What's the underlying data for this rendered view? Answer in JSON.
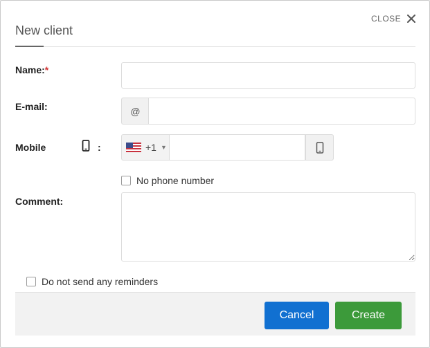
{
  "dialog": {
    "title": "New client",
    "close_label": "CLOSE"
  },
  "form": {
    "name": {
      "label": "Name:",
      "required_mark": "*",
      "value": ""
    },
    "email": {
      "label": "E-mail:",
      "addon": "@",
      "value": ""
    },
    "mobile": {
      "label": "Mobile",
      "colon": ":",
      "country_code": "+1",
      "value": ""
    },
    "no_phone": {
      "label": "No phone number",
      "checked": false
    },
    "comment": {
      "label": "Comment:",
      "value": ""
    },
    "no_reminders": {
      "label": "Do not send any reminders",
      "checked": false
    }
  },
  "footer": {
    "cancel_label": "Cancel",
    "create_label": "Create"
  },
  "colors": {
    "cancel": "#1170d1",
    "create": "#3c9a3a",
    "required": "#d23333"
  },
  "icons": {
    "close": "close-icon",
    "mobile": "mobile-phone-icon",
    "flag": "us-flag-icon",
    "caret": "caret-down-icon"
  }
}
